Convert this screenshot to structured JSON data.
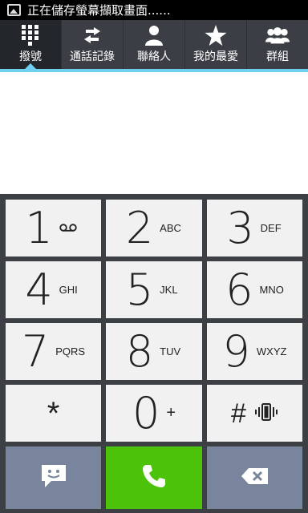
{
  "status_bar": {
    "message": "正在儲存螢幕擷取畫面......",
    "icon": "image-icon"
  },
  "tabs": [
    {
      "label": "撥號",
      "icon": "dialpad-icon",
      "active": true
    },
    {
      "label": "通話記錄",
      "icon": "call-log-icon",
      "active": false
    },
    {
      "label": "聯絡人",
      "icon": "contact-icon",
      "active": false
    },
    {
      "label": "我的最愛",
      "icon": "star-icon",
      "active": false
    },
    {
      "label": "群組",
      "icon": "group-icon",
      "active": false
    }
  ],
  "display": {
    "number": ""
  },
  "keypad": {
    "keys": [
      {
        "digit": "1",
        "letters": "",
        "extra_icon": "voicemail-icon"
      },
      {
        "digit": "2",
        "letters": "ABC"
      },
      {
        "digit": "3",
        "letters": "DEF"
      },
      {
        "digit": "4",
        "letters": "GHI"
      },
      {
        "digit": "5",
        "letters": "JKL"
      },
      {
        "digit": "6",
        "letters": "MNO"
      },
      {
        "digit": "7",
        "letters": "PQRS"
      },
      {
        "digit": "8",
        "letters": "TUV"
      },
      {
        "digit": "9",
        "letters": "WXYZ"
      },
      {
        "digit": "*",
        "letters": ""
      },
      {
        "digit": "0",
        "letters": "+"
      },
      {
        "digit": "#",
        "letters": "",
        "extra_icon": "vibrate-icon"
      }
    ],
    "bottom": {
      "left_icon": "message-icon",
      "center_icon": "phone-call-icon",
      "right_icon": "backspace-icon"
    }
  },
  "colors": {
    "tab_accent": "#6fd0ef",
    "call_green": "#4cc20b",
    "bottom_gray": "#78859c",
    "key_bg": "#f1f1f1"
  }
}
